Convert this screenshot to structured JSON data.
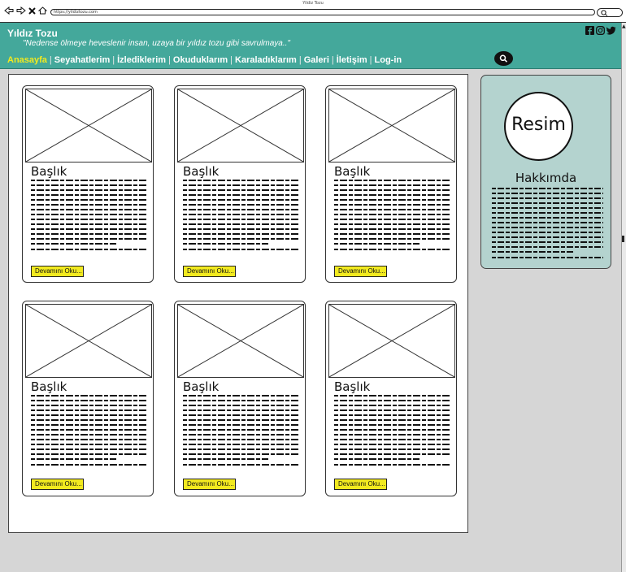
{
  "window": {
    "title": "Yildiz Tozu"
  },
  "browser": {
    "url": "https://yildiztozu.com"
  },
  "header": {
    "site_title": "Yıldız Tozu",
    "tagline": "\"Nedense ölmeye heveslenir insan, uzaya bir yıldız tozu gibi savrulmaya..\"",
    "social_icons": [
      "facebook-icon",
      "instagram-icon",
      "twitter-icon"
    ]
  },
  "nav": {
    "items": [
      {
        "label": "Anasayfa",
        "active": true
      },
      {
        "label": "Seyahatlerim",
        "active": false
      },
      {
        "label": "İzlediklerim",
        "active": false
      },
      {
        "label": "Okuduklarım",
        "active": false
      },
      {
        "label": "Karaladıklarım",
        "active": false
      },
      {
        "label": "Galeri",
        "active": false
      },
      {
        "label": "İletişim",
        "active": false
      },
      {
        "label": "Log-in",
        "active": false
      }
    ],
    "separator": "|"
  },
  "cards": [
    {
      "title": "Başlık",
      "button": "Devamını Oku..."
    },
    {
      "title": "Başlık",
      "button": "Devamını Oku..."
    },
    {
      "title": "Başlık",
      "button": "Devamını Oku..."
    },
    {
      "title": "Başlık",
      "button": "Devamını Oku..."
    },
    {
      "title": "Başlık",
      "button": "Devamını Oku..."
    },
    {
      "title": "Başlık",
      "button": "Devamını Oku..."
    }
  ],
  "sidebar": {
    "avatar_label": "Resim",
    "about_title": "Hakkımda"
  },
  "colors": {
    "header_bg": "#44a89b",
    "nav_active": "#f2ea1f",
    "button_bg": "#f2ea1f",
    "sidebar_bg": "#b4d3cf",
    "page_bg": "#d6d6d6"
  }
}
